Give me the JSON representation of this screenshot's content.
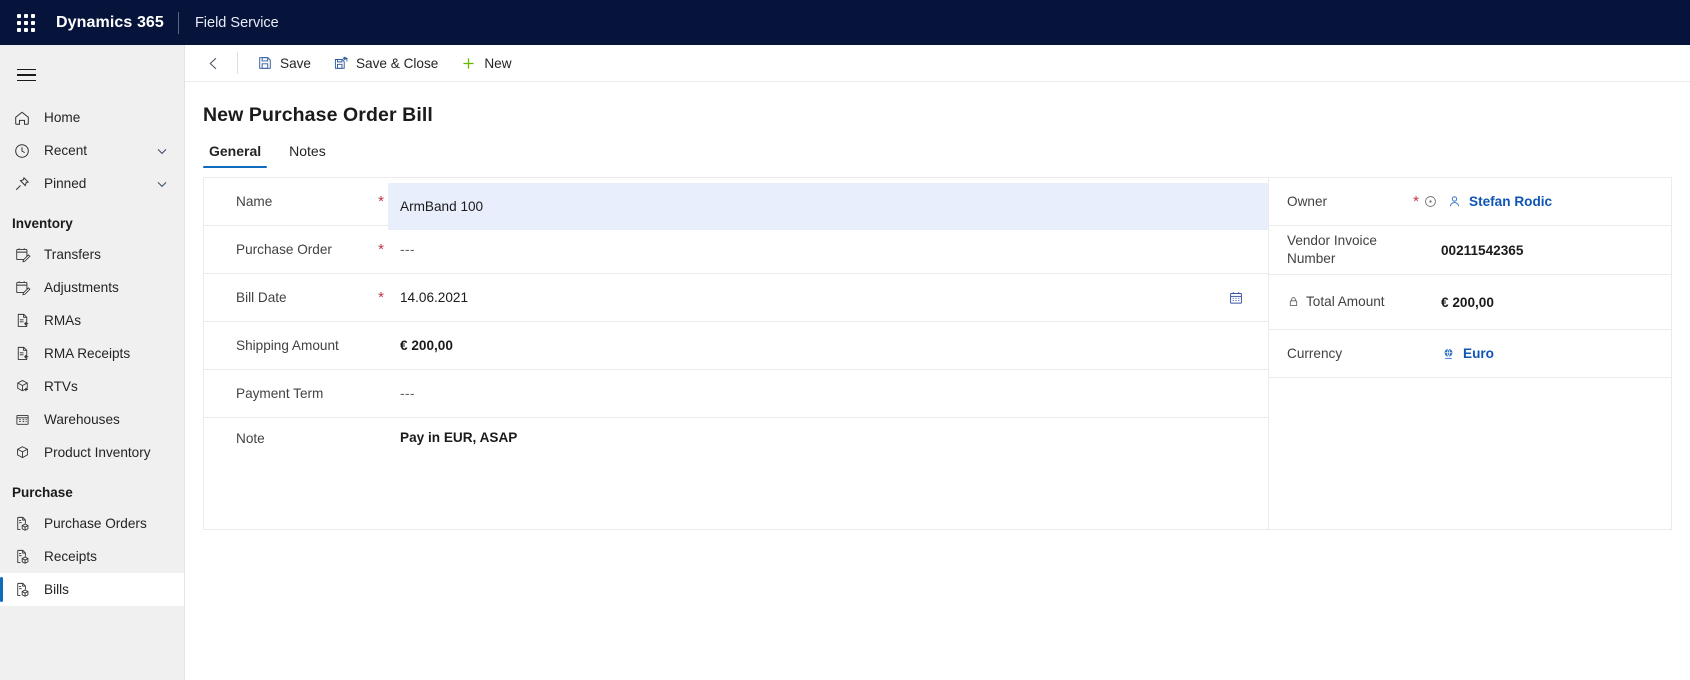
{
  "appbar": {
    "waffle_icon": "waffle-grid-icon",
    "brand": "Dynamics 365",
    "app_name": "Field Service"
  },
  "sidebar": {
    "hamburger_icon": "hamburger-menu-icon",
    "top_items": [
      {
        "label": "Home",
        "icon": "home-icon",
        "expandable": false
      },
      {
        "label": "Recent",
        "icon": "clock-icon",
        "expandable": true
      },
      {
        "label": "Pinned",
        "icon": "pin-icon",
        "expandable": true
      }
    ],
    "groups": [
      {
        "title": "Inventory",
        "items": [
          {
            "label": "Transfers",
            "icon": "transfers-icon"
          },
          {
            "label": "Adjustments",
            "icon": "adjustments-icon"
          },
          {
            "label": "RMAs",
            "icon": "rma-icon"
          },
          {
            "label": "RMA Receipts",
            "icon": "rma-receipts-icon"
          },
          {
            "label": "RTVs",
            "icon": "rtv-box-icon"
          },
          {
            "label": "Warehouses",
            "icon": "warehouse-icon"
          },
          {
            "label": "Product Inventory",
            "icon": "product-box-icon"
          }
        ]
      },
      {
        "title": "Purchase",
        "items": [
          {
            "label": "Purchase Orders",
            "icon": "purchase-order-icon",
            "selected": false
          },
          {
            "label": "Receipts",
            "icon": "receipts-icon",
            "selected": false
          },
          {
            "label": "Bills",
            "icon": "bills-icon",
            "selected": true
          }
        ]
      }
    ]
  },
  "commandbar": {
    "back_icon": "back-arrow-icon",
    "save": {
      "label": "Save",
      "icon": "save-disk-icon"
    },
    "save_close": {
      "label": "Save & Close",
      "icon": "save-close-icon"
    },
    "new": {
      "label": "New",
      "icon": "plus-icon"
    }
  },
  "page": {
    "title": "New Purchase Order Bill",
    "tabs": [
      {
        "label": "General",
        "active": true
      },
      {
        "label": "Notes",
        "active": false
      }
    ]
  },
  "form": {
    "left": {
      "name": {
        "label": "Name",
        "required": true,
        "value": "ArmBand 100",
        "focused": true
      },
      "purchase_order": {
        "label": "Purchase Order",
        "required": true,
        "value": "---"
      },
      "bill_date": {
        "label": "Bill Date",
        "required": true,
        "value": "14.06.2021",
        "icon": "calendar-icon"
      },
      "shipping_amount": {
        "label": "Shipping Amount",
        "required": false,
        "value": "€ 200,00"
      },
      "payment_term": {
        "label": "Payment Term",
        "required": false,
        "value": "---"
      },
      "note": {
        "label": "Note",
        "required": false,
        "value": "Pay in EUR, ASAP"
      }
    },
    "right": {
      "owner": {
        "label": "Owner",
        "required": true,
        "value": "Stefan Rodic",
        "icons": [
          "clock-recent-icon",
          "person-icon"
        ]
      },
      "vendor_invoice_number": {
        "label": "Vendor Invoice Number",
        "value": "00211542365"
      },
      "total_amount": {
        "label": "Total Amount",
        "value": "€ 200,00",
        "icon": "lock-icon",
        "readonly": true
      },
      "currency": {
        "label": "Currency",
        "value": "Euro",
        "icon": "currency-globe-icon"
      }
    }
  },
  "colors": {
    "appbar_bg": "#06143c",
    "accent": "#0f6cbd",
    "link": "#0f55b5",
    "required": "#c4314b",
    "sidebar_bg": "#f0f0f0",
    "focus_field_bg": "#e8eefb",
    "new_icon_green": "#6bb700"
  }
}
